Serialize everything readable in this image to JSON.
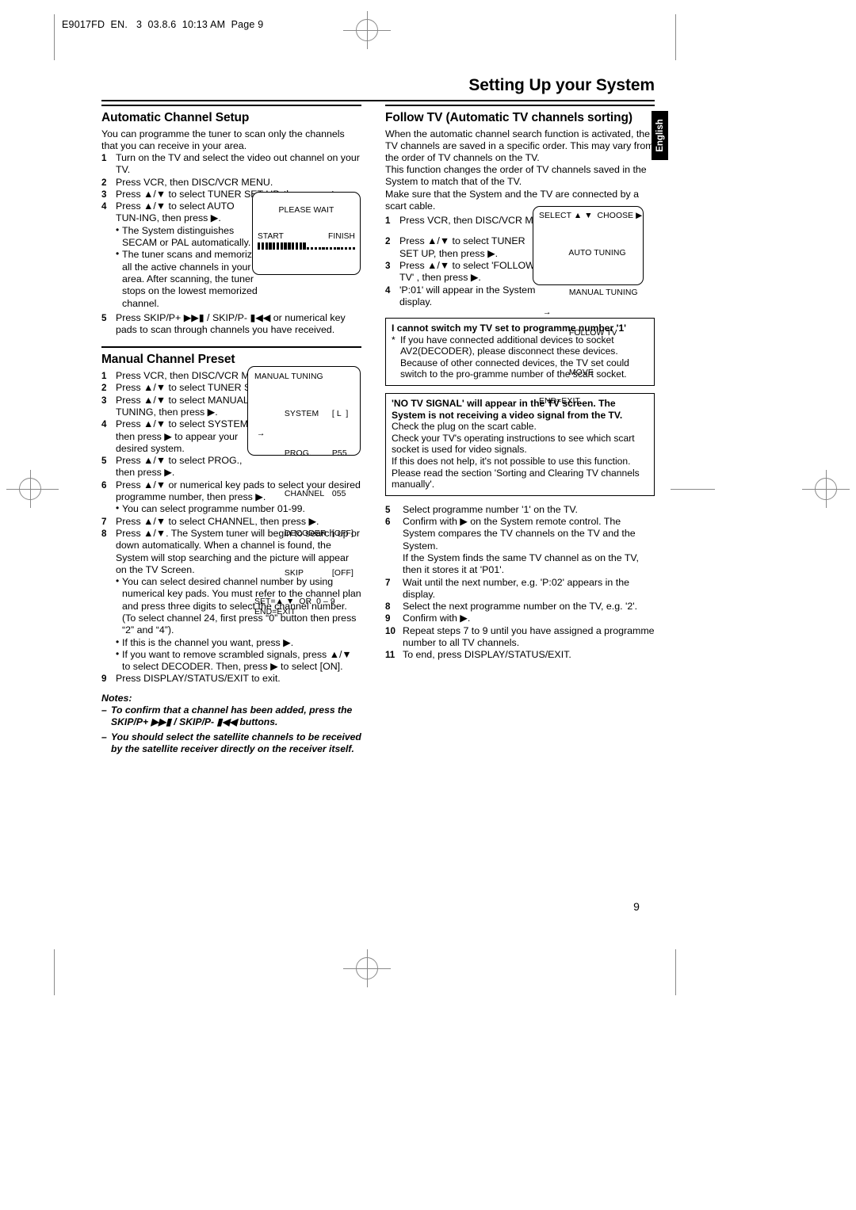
{
  "slug": "E9017FD  EN.   3  03.8.6  10:13 AM  Page 9",
  "page_title": "Setting Up your System",
  "page_number": "9",
  "language_tab": "English",
  "left_column": {
    "automatic_channel_setup": {
      "heading": "Automatic Channel Setup",
      "intro": "You can programme the tuner to scan only the channels that you can receive in your area.",
      "steps": [
        {
          "num": "1",
          "text": "Turn on the TV and select the video out channel on your TV."
        },
        {
          "num": "2",
          "text": "Press VCR, then DISC/VCR MENU."
        },
        {
          "num": "3",
          "text": "Press ▲/▼ to select TUNER SET UP, then press ▶."
        },
        {
          "num": "4",
          "text": "Press ▲/▼ to select AUTO TUN-ING, then press ▶."
        }
      ],
      "bullets": [
        "The System distinguishes SECAM or PAL automatically.",
        "The tuner scans and memorizes all the active channels in your area. After scanning, the tuner stops on the lowest memorized channel."
      ],
      "step5": {
        "num": "5",
        "text": "Press SKIP/P+ ▶▶▮ / SKIP/P- ▮◀◀ or numerical key pads to scan through channels you have received."
      },
      "osd_please_wait": {
        "title": "PLEASE WAIT",
        "start_label": "START",
        "finish_label": "FINISH",
        "filled_segments": 13,
        "empty_segments": 13
      }
    },
    "manual_channel_preset": {
      "heading": "Manual Channel Preset",
      "steps": [
        {
          "num": "1",
          "text": "Press VCR, then DISC/VCR MENU."
        },
        {
          "num": "2",
          "text": "Press ▲/▼ to select TUNER SET UP, then press ▶."
        },
        {
          "num": "3",
          "text": "Press ▲/▼ to select MANUAL TUNING, then press ▶."
        },
        {
          "num": "4",
          "text": "Press ▲/▼ to select SYSTEM, then press ▶ to appear your desired system."
        },
        {
          "num": "5",
          "text": "Press ▲/▼ to select PROG., then press ▶."
        },
        {
          "num": "6",
          "text": "Press ▲/▼ or numerical key pads to select your desired programme number, then press ▶."
        }
      ],
      "bullet_after_6": "You can select programme number 01-99.",
      "steps_cont": [
        {
          "num": "7",
          "text": "Press ▲/▼ to select CHANNEL, then press ▶."
        },
        {
          "num": "8",
          "text": "Press ▲/▼. The System tuner will begin to search up or down automatically. When a channel is found, the System will stop searching and the picture will appear on the TV Screen."
        }
      ],
      "bullets_after_8": [
        "You can select desired channel number by using numerical key pads. You must refer to the channel plan and press three digits to select the channel number. (To select channel 24, first press “0” button then press “2” and “4”).",
        "If this is the channel you want, press ▶.",
        "If you want to remove scrambled signals, press ▲/▼ to select DECODER. Then, press ▶ to select [ON]."
      ],
      "step9": {
        "num": "9",
        "text": "Press DISPLAY/STATUS/EXIT to exit."
      },
      "notes_label": "Notes:",
      "notes": [
        "To confirm that a channel has been added, press the SKIP/P+ ▶▶▮ / SKIP/P- ▮◀◀ buttons.",
        "You should select the satellite channels to be received by the satellite receiver directly on the receiver itself."
      ],
      "osd_manual_tuning": {
        "title": "MANUAL TUNING",
        "rows": [
          {
            "arrow": "",
            "name": "SYSTEM",
            "value": "[ L  ]"
          },
          {
            "arrow": "→",
            "name": "PROG.",
            "value": "P55"
          },
          {
            "arrow": "",
            "name": "CHANNEL",
            "value": "055"
          },
          {
            "arrow": "",
            "name": "DECODER",
            "value": "[OFF]"
          },
          {
            "arrow": "",
            "name": "SKIP",
            "value": "[OFF]"
          }
        ],
        "footer_line1": "SET=▲ ▼  OR  0 – 9",
        "footer_line2": "END=EXIT"
      }
    }
  },
  "right_column": {
    "follow_tv": {
      "heading": "Follow TV (Automatic TV channels sorting)",
      "paragraphs": [
        "When the automatic channel search function is activated, the TV channels are saved in a specific order. This may vary from the order of TV channels on the TV.",
        "This function changes the order of TV channels saved in the System to match that of the TV.",
        "Make sure that the System and the TV are connected by a scart cable."
      ],
      "steps": [
        {
          "num": "1",
          "text": "Press VCR, then DISC/VCR MENU."
        },
        {
          "num": "2",
          "text": "Press ▲/▼ to select TUNER SET UP, then press ▶."
        },
        {
          "num": "3",
          "text": "Press ▲/▼ to select 'FOLLOW TV' , then press ▶."
        },
        {
          "num": "4",
          "text": "'P:01' will appear in the System display."
        }
      ],
      "osd_select_menu": {
        "title": "SELECT ▲ ▼  CHOOSE ▶",
        "items": [
          {
            "arrow": "",
            "label": "AUTO TUNING"
          },
          {
            "arrow": "",
            "label": "MANUAL TUNING"
          },
          {
            "arrow": "→",
            "label": "FOLLOW TV"
          },
          {
            "arrow": "",
            "label": "MOVE"
          }
        ],
        "footer": "END=EXIT"
      },
      "callout_1": {
        "head": "I cannot switch my TV set to programme number '1'",
        "star": "*",
        "body": "If you have connected additional devices to socket AV2(DECODER), please disconnect these devices. Because of other connected devices, the TV set could switch to the pro-gramme number of the scart socket."
      },
      "callout_2": {
        "head": "'NO TV SIGNAL' will appear in the TV screen. The System is not receiving a video signal from the TV.",
        "body_lines": [
          "Check the plug on the scart cable.",
          "Check your TV's operating instructions to see which scart socket is used for video signals.",
          "If this does not help, it's not possible to use this function. Please read the section 'Sorting and Clearing TV channels manually'."
        ]
      },
      "steps_cont": [
        {
          "num": "5",
          "text": "Select programme number '1' on the TV."
        },
        {
          "num": "6",
          "text": "Confirm with ▶ on the System remote control. The System compares the TV channels on the TV and the System."
        },
        {
          "num": "",
          "text": "If the System finds the same TV channel as on the TV, then it stores it at 'P01'."
        },
        {
          "num": "7",
          "text": "Wait until the next number, e.g. 'P:02' appears in the display."
        },
        {
          "num": "8",
          "text": "Select the next programme number on the TV, e.g. '2'."
        },
        {
          "num": "9",
          "text": "Confirm with ▶."
        },
        {
          "num": "10",
          "text": "Repeat steps 7 to 9 until you have assigned a programme number to all TV channels."
        },
        {
          "num": "11",
          "text": "To end, press DISPLAY/STATUS/EXIT."
        }
      ]
    }
  }
}
